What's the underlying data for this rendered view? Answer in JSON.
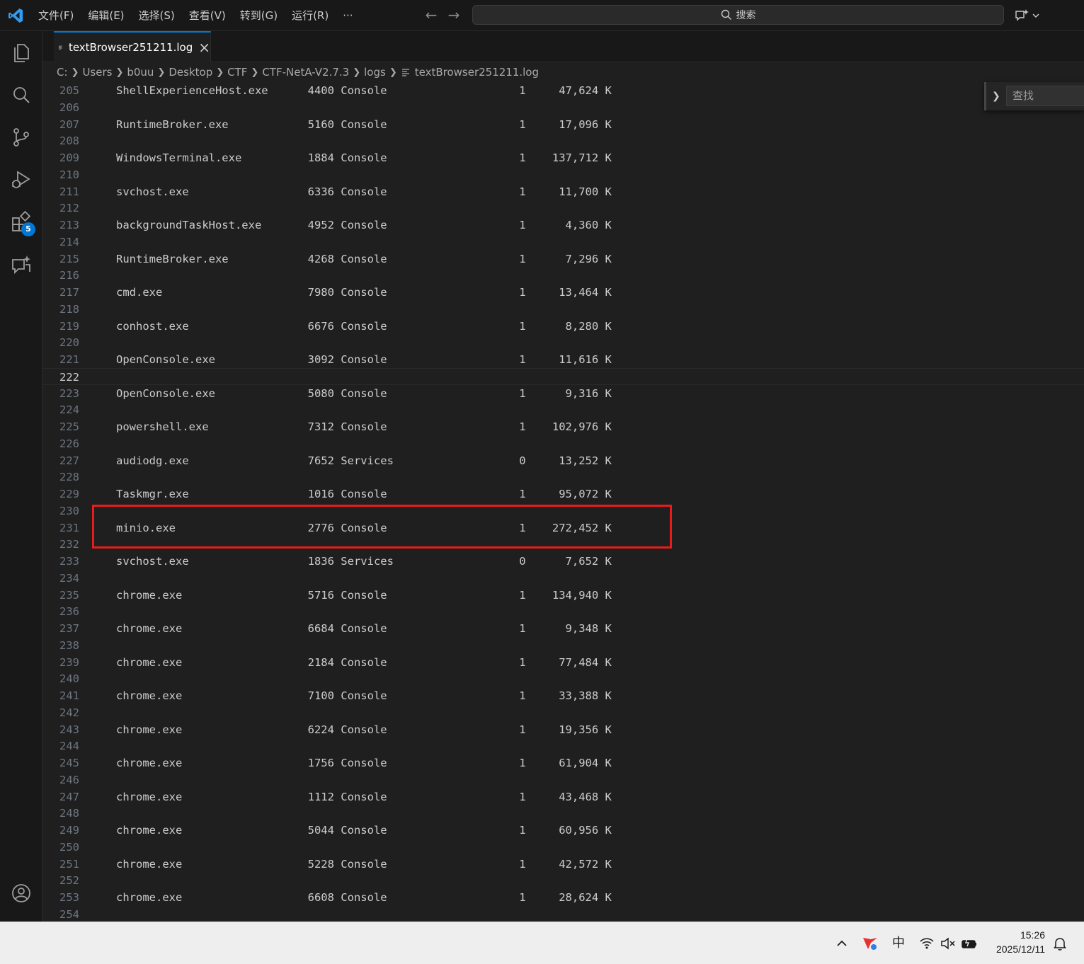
{
  "menu": [
    "文件(F)",
    "编辑(E)",
    "选择(S)",
    "查看(V)",
    "转到(G)",
    "运行(R)",
    "···"
  ],
  "search": {
    "label": "搜索"
  },
  "activity": {
    "extensions_badge": "5"
  },
  "tab": {
    "label": "textBrowser251211.log"
  },
  "breadcrumb": [
    "C:",
    "Users",
    "b0uu",
    "Desktop",
    "CTF",
    "CTF-NetA-V2.7.3",
    "logs",
    "textBrowser251211.log"
  ],
  "editor": {
    "current_line": "222",
    "lines": [
      {
        "n": "205",
        "t": "ShellExperienceHost.exe      4400 Console                    1     47,624 K"
      },
      {
        "n": "206",
        "t": ""
      },
      {
        "n": "207",
        "t": "RuntimeBroker.exe            5160 Console                    1     17,096 K"
      },
      {
        "n": "208",
        "t": ""
      },
      {
        "n": "209",
        "t": "WindowsTerminal.exe          1884 Console                    1    137,712 K"
      },
      {
        "n": "210",
        "t": ""
      },
      {
        "n": "211",
        "t": "svchost.exe                  6336 Console                    1     11,700 K"
      },
      {
        "n": "212",
        "t": ""
      },
      {
        "n": "213",
        "t": "backgroundTaskHost.exe       4952 Console                    1      4,360 K"
      },
      {
        "n": "214",
        "t": ""
      },
      {
        "n": "215",
        "t": "RuntimeBroker.exe            4268 Console                    1      7,296 K"
      },
      {
        "n": "216",
        "t": ""
      },
      {
        "n": "217",
        "t": "cmd.exe                      7980 Console                    1     13,464 K"
      },
      {
        "n": "218",
        "t": ""
      },
      {
        "n": "219",
        "t": "conhost.exe                  6676 Console                    1      8,280 K"
      },
      {
        "n": "220",
        "t": ""
      },
      {
        "n": "221",
        "t": "OpenConsole.exe              3092 Console                    1     11,616 K"
      },
      {
        "n": "222",
        "t": ""
      },
      {
        "n": "223",
        "t": "OpenConsole.exe              5080 Console                    1      9,316 K"
      },
      {
        "n": "224",
        "t": ""
      },
      {
        "n": "225",
        "t": "powershell.exe               7312 Console                    1    102,976 K"
      },
      {
        "n": "226",
        "t": ""
      },
      {
        "n": "227",
        "t": "audiodg.exe                  7652 Services                   0     13,252 K"
      },
      {
        "n": "228",
        "t": ""
      },
      {
        "n": "229",
        "t": "Taskmgr.exe                  1016 Console                    1     95,072 K"
      },
      {
        "n": "230",
        "t": ""
      },
      {
        "n": "231",
        "t": "minio.exe                    2776 Console                    1    272,452 K"
      },
      {
        "n": "232",
        "t": ""
      },
      {
        "n": "233",
        "t": "svchost.exe                  1836 Services                   0      7,652 K"
      },
      {
        "n": "234",
        "t": ""
      },
      {
        "n": "235",
        "t": "chrome.exe                   5716 Console                    1    134,940 K"
      },
      {
        "n": "236",
        "t": ""
      },
      {
        "n": "237",
        "t": "chrome.exe                   6684 Console                    1      9,348 K"
      },
      {
        "n": "238",
        "t": ""
      },
      {
        "n": "239",
        "t": "chrome.exe                   2184 Console                    1     77,484 K"
      },
      {
        "n": "240",
        "t": ""
      },
      {
        "n": "241",
        "t": "chrome.exe                   7100 Console                    1     33,388 K"
      },
      {
        "n": "242",
        "t": ""
      },
      {
        "n": "243",
        "t": "chrome.exe                   6224 Console                    1     19,356 K"
      },
      {
        "n": "244",
        "t": ""
      },
      {
        "n": "245",
        "t": "chrome.exe                   1756 Console                    1     61,904 K"
      },
      {
        "n": "246",
        "t": ""
      },
      {
        "n": "247",
        "t": "chrome.exe                   1112 Console                    1     43,468 K"
      },
      {
        "n": "248",
        "t": ""
      },
      {
        "n": "249",
        "t": "chrome.exe                   5044 Console                    1     60,956 K"
      },
      {
        "n": "250",
        "t": ""
      },
      {
        "n": "251",
        "t": "chrome.exe                   5228 Console                    1     42,572 K"
      },
      {
        "n": "252",
        "t": ""
      },
      {
        "n": "253",
        "t": "chrome.exe                   6608 Console                    1     28,624 K"
      },
      {
        "n": "254",
        "t": ""
      }
    ]
  },
  "find": {
    "placeholder": "查找"
  },
  "taskbar": {
    "ime": "中",
    "time": "15:26",
    "date": "2025/12/11"
  },
  "colors": {
    "accent": "#0078d4",
    "highlight_box": "#e81c1c",
    "editor_bg": "#1f1f1f"
  },
  "icons": [
    "vscode-logo-icon",
    "explorer-icon",
    "search-icon",
    "source-control-icon",
    "run-debug-icon",
    "extensions-icon",
    "chat-icon",
    "account-icon",
    "arrow-left-icon",
    "arrow-right-icon",
    "copilot-icon",
    "file-lines-icon",
    "close-icon",
    "chevron-right-icon",
    "tray-chevron-up-icon",
    "antivirus-icon",
    "wifi-icon",
    "speaker-muted-icon",
    "battery-icon",
    "notification-bell-icon"
  ]
}
